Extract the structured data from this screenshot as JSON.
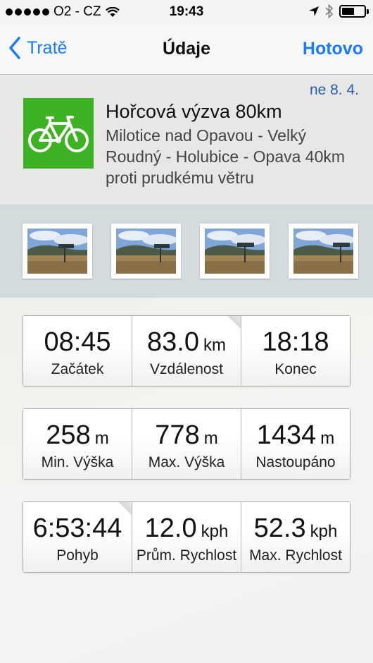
{
  "status_bar": {
    "carrier": "O2 - CZ",
    "time": "19:43",
    "signal_icon": "signal-dots-icon",
    "wifi_icon": "wifi-icon",
    "location_icon": "location-arrow-icon",
    "bluetooth_icon": "bluetooth-icon",
    "battery_icon": "battery-icon",
    "battery_level": 0.55
  },
  "nav": {
    "back_label": "Tratě",
    "title": "Údaje",
    "done_label": "Hotovo"
  },
  "route": {
    "date": "ne 8. 4.",
    "icon": "bicycle-icon",
    "icon_color": "#3db323",
    "name": "Hořcová výzva 80km",
    "description": "Milotice nad Opavou - Velký Roudný - Holubice - Opava 40km proti prudkému větru"
  },
  "photos": [
    {
      "icon": "landscape-photo"
    },
    {
      "icon": "landscape-photo"
    },
    {
      "icon": "landscape-photo"
    },
    {
      "icon": "landscape-photo"
    }
  ],
  "stats": [
    [
      {
        "value": "08:45",
        "unit": "",
        "label": "Začátek"
      },
      {
        "value": "83.0",
        "unit": "km",
        "label": "Vzdálenost"
      },
      {
        "value": "18:18",
        "unit": "",
        "label": "Konec"
      }
    ],
    [
      {
        "value": "258",
        "unit": "m",
        "label": "Min. Výška"
      },
      {
        "value": "778",
        "unit": "m",
        "label": "Max. Výška"
      },
      {
        "value": "1434",
        "unit": "m",
        "label": "Nastoupáno"
      }
    ],
    [
      {
        "value": "6:53:44",
        "unit": "",
        "label": "Pohyb"
      },
      {
        "value": "12.0",
        "unit": "kph",
        "label": "Prům. Rychlost"
      },
      {
        "value": "52.3",
        "unit": "kph",
        "label": "Max. Rychlost"
      }
    ]
  ],
  "colors": {
    "accent": "#1a7cf2",
    "date": "#2a5cb4"
  }
}
